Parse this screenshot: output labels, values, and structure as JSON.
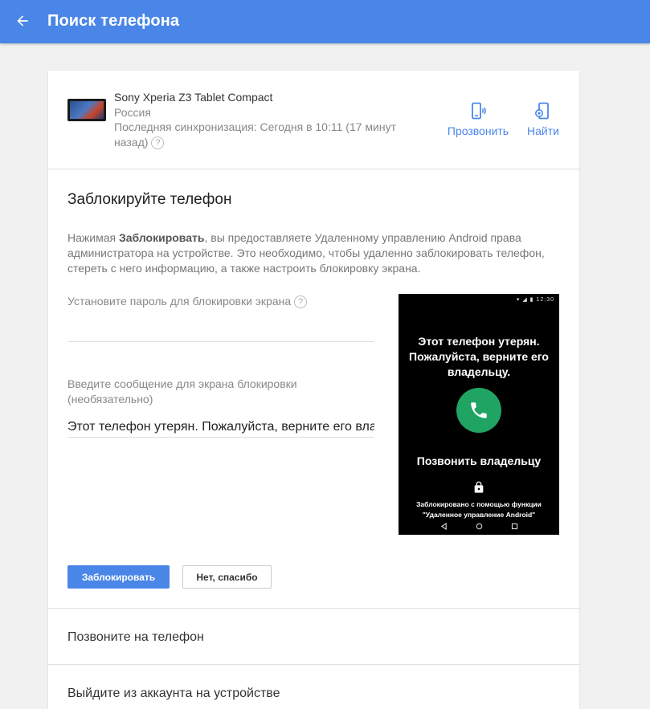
{
  "header": {
    "title": "Поиск телефона",
    "back_icon": "arrow-left-icon",
    "bg_color": "#4a86e8"
  },
  "device": {
    "name": "Sony Xperia Z3 Tablet Compact",
    "country": "Россия",
    "last_sync": "Последняя синхронизация: Сегодня в 10:11 (17 минут назад)",
    "help_glyph": "?",
    "actions": {
      "ring_label": "Прозвонить",
      "find_label": "Найти"
    }
  },
  "lock": {
    "title": "Заблокируйте телефон",
    "desc_prefix": "Нажимая ",
    "desc_bold": "Заблокировать",
    "desc_suffix": ", вы предоставляете Удаленному управлению Android права администратора на устройстве. Это необходимо, чтобы удаленно заблокировать телефон, стереть с него информацию, а также настроить блокировку экрана.",
    "password_label": "Установите пароль для блокировки экрана",
    "password_help": "?",
    "password_value": "",
    "message_label": "Введите сообщение для экрана блокировки (необязательно)",
    "message_value": "Этот телефон утерян. Пожалуйста, верните его владельцу."
  },
  "preview": {
    "status_time": "12:30",
    "message": "Этот телефон утерян. Пожалуйста, верните его владельцу.",
    "call_owner": "Позвонить владельцу",
    "locked_by": "Заблокировано с помощью функции \"Удаленное управление Android\"",
    "call_color": "#1fa463"
  },
  "buttons": {
    "lock": "Заблокировать",
    "cancel": "Нет, спасибо"
  },
  "sections": {
    "call": "Позвоните на телефон",
    "signout": "Выйдите из аккаунта на устройстве"
  }
}
